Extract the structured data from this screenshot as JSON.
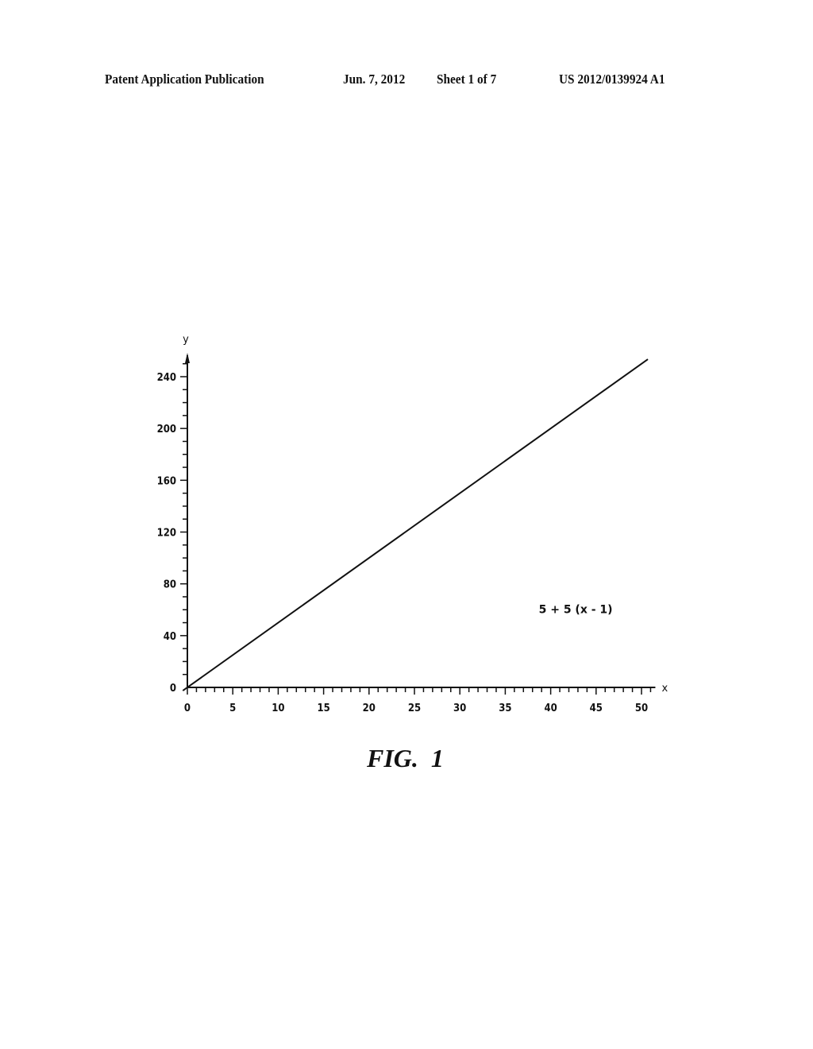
{
  "header": {
    "publication": "Patent Application Publication",
    "date": "Jun. 7, 2012",
    "sheet": "Sheet 1 of 7",
    "number": "US 2012/0139924 A1"
  },
  "figure_label": "FIG.  1",
  "chart_data": {
    "type": "line",
    "title": "",
    "xlabel": "x",
    "ylabel": "y",
    "xlim": [
      0,
      51
    ],
    "ylim": [
      0,
      250
    ],
    "x_ticks": [
      0,
      5,
      10,
      15,
      20,
      25,
      30,
      35,
      40,
      45,
      50
    ],
    "x_minor_step": 1,
    "y_ticks": [
      0,
      40,
      80,
      120,
      160,
      200,
      240
    ],
    "y_minor_step": 10,
    "grid": false,
    "series": [
      {
        "name": "5 + 5 (x - 1)",
        "x": [
          -0.5,
          50.7
        ],
        "y": [
          -2.5,
          253.5
        ]
      }
    ],
    "annotations": [
      {
        "text": "5 + 5 (x - 1)",
        "x": 40,
        "y": 60
      }
    ]
  }
}
